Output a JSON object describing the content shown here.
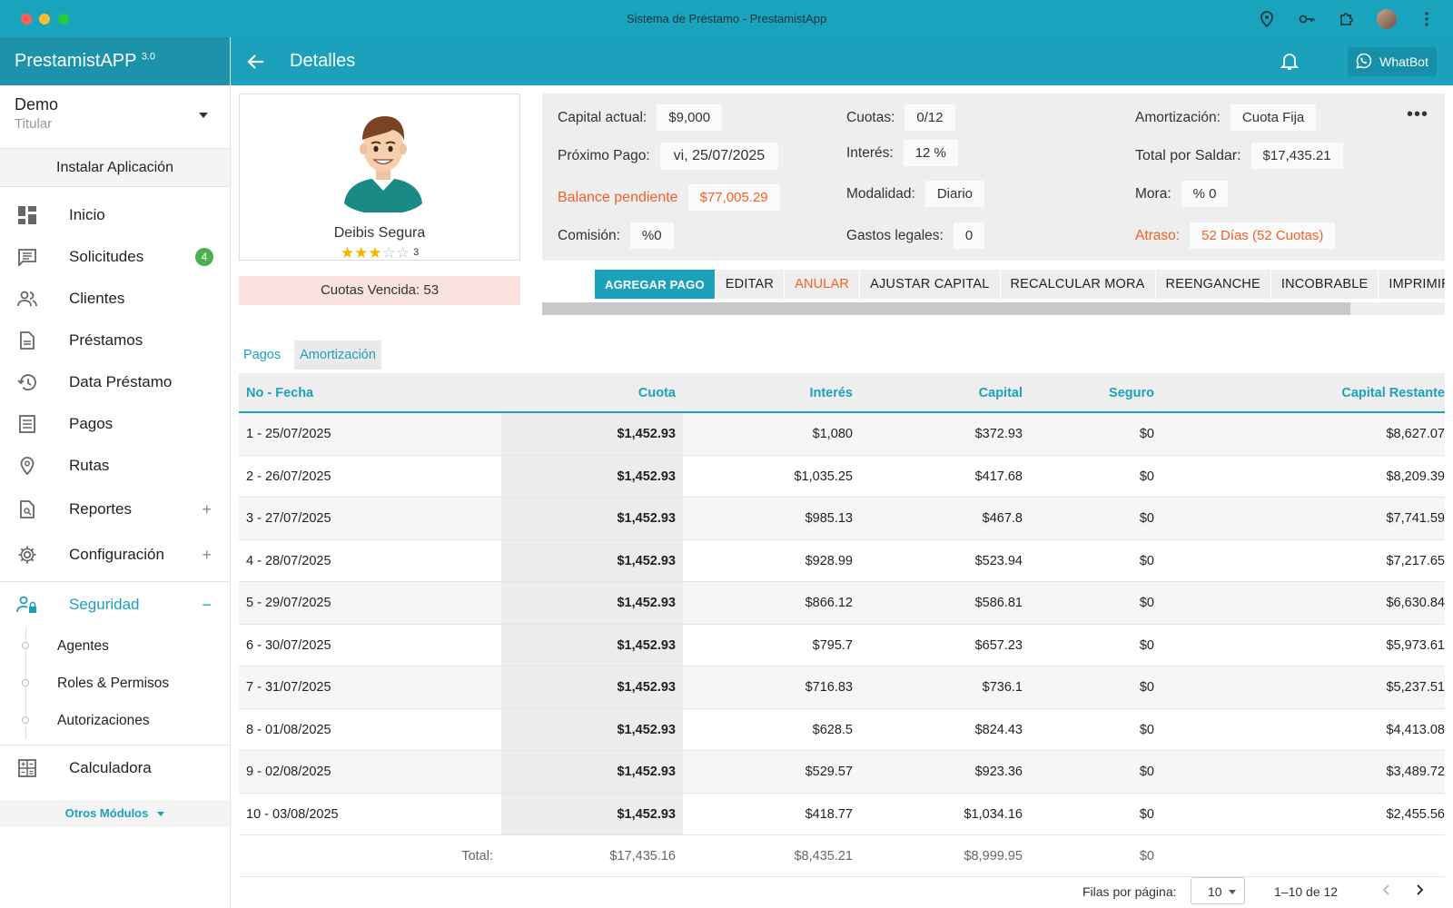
{
  "window": {
    "title": "Sistema de Préstamo - PrestamistApp"
  },
  "brand": {
    "name": "PrestamistAPP",
    "version": "3.0"
  },
  "account": {
    "name": "Demo",
    "role": "Titular"
  },
  "install_label": "Instalar Aplicación",
  "nav": {
    "items": [
      {
        "label": "Inicio",
        "icon": "dashboard-icon"
      },
      {
        "label": "Solicitudes",
        "icon": "chat-icon",
        "badge": "4"
      },
      {
        "label": "Clientes",
        "icon": "people-icon"
      },
      {
        "label": "Préstamos",
        "icon": "document-icon"
      },
      {
        "label": "Data Préstamo",
        "icon": "history-icon"
      },
      {
        "label": "Pagos",
        "icon": "list-icon"
      },
      {
        "label": "Rutas",
        "icon": "location-pin-icon"
      },
      {
        "label": "Reportes",
        "icon": "report-search-icon",
        "expand": "+"
      },
      {
        "label": "Configuración",
        "icon": "gear-icon",
        "expand": "+"
      },
      {
        "label": "Seguridad",
        "icon": "user-lock-icon",
        "expand": "−"
      }
    ],
    "seguridad_sub": [
      "Agentes",
      "Roles & Permisos",
      "Autorizaciones"
    ],
    "calculadora": "Calculadora",
    "otros_modulos": "Otros Módulos"
  },
  "header": {
    "title": "Detalles",
    "whatbot_label": "WhatBot"
  },
  "client": {
    "name": "Deibis Segura",
    "rating_stars": 3,
    "rating_max": 5,
    "rating_count": "3"
  },
  "cuotas_vencida": "Cuotas Vencida: 53",
  "info": {
    "capital_actual": {
      "label": "Capital actual:",
      "value": "$9,000"
    },
    "proximo_pago": {
      "label": "Próximo Pago:",
      "value": "vi, 25/07/2025"
    },
    "balance_pendiente": {
      "label": "Balance pendiente",
      "value": "$77,005.29"
    },
    "comision": {
      "label": "Comisión:",
      "value": "%0"
    },
    "cuotas": {
      "label": "Cuotas:",
      "value": "0/12"
    },
    "interes": {
      "label": "Interés:",
      "value": "12 %"
    },
    "modalidad": {
      "label": "Modalidad:",
      "value": "Diario"
    },
    "gastos_legales": {
      "label": "Gastos legales:",
      "value": "0"
    },
    "amortizacion": {
      "label": "Amortización:",
      "value": "Cuota Fija"
    },
    "total_por_saldar": {
      "label": "Total por Saldar:",
      "value": "$17,435.21"
    },
    "mora": {
      "label": "Mora:",
      "value": "% 0"
    },
    "atraso": {
      "label": "Atraso:",
      "value": "52 Días (52 Cuotas)"
    },
    "more_label": "•••"
  },
  "actions": [
    "AGREGAR PAGO",
    "EDITAR",
    "ANULAR",
    "AJUSTAR CAPITAL",
    "RECALCULAR MORA",
    "REENGANCHE",
    "INCOBRABLE",
    "IMPRIMIR"
  ],
  "tabs": [
    "Pagos",
    "Amortización"
  ],
  "table": {
    "columns": [
      "No - Fecha",
      "Cuota",
      "Interés",
      "Capital",
      "Seguro",
      "Capital Restante"
    ],
    "rows": [
      [
        "1 - 25/07/2025",
        "$1,452.93",
        "$1,080",
        "$372.93",
        "$0",
        "$8,627.07"
      ],
      [
        "2 - 26/07/2025",
        "$1,452.93",
        "$1,035.25",
        "$417.68",
        "$0",
        "$8,209.39"
      ],
      [
        "3 - 27/07/2025",
        "$1,452.93",
        "$985.13",
        "$467.8",
        "$0",
        "$7,741.59"
      ],
      [
        "4 - 28/07/2025",
        "$1,452.93",
        "$928.99",
        "$523.94",
        "$0",
        "$7,217.65"
      ],
      [
        "5 - 29/07/2025",
        "$1,452.93",
        "$866.12",
        "$586.81",
        "$0",
        "$6,630.84"
      ],
      [
        "6 - 30/07/2025",
        "$1,452.93",
        "$795.7",
        "$657.23",
        "$0",
        "$5,973.61"
      ],
      [
        "7 - 31/07/2025",
        "$1,452.93",
        "$716.83",
        "$736.1",
        "$0",
        "$5,237.51"
      ],
      [
        "8 - 01/08/2025",
        "$1,452.93",
        "$628.5",
        "$824.43",
        "$0",
        "$4,413.08"
      ],
      [
        "9 - 02/08/2025",
        "$1,452.93",
        "$529.57",
        "$923.36",
        "$0",
        "$3,489.72"
      ],
      [
        "10 - 03/08/2025",
        "$1,452.93",
        "$418.77",
        "$1,034.16",
        "$0",
        "$2,455.56"
      ]
    ],
    "totals": {
      "label": "Total:",
      "cuota": "$17,435.16",
      "interes": "$8,435.21",
      "capital": "$8,999.95",
      "seguro": "$0"
    }
  },
  "pagination": {
    "rows_label": "Filas por página:",
    "rows_value": "10",
    "range": "1–10 de 12"
  },
  "colors": {
    "primary": "#1ba1bc",
    "header": "#1ba1bc",
    "brand_bar": "#1c93ab",
    "warning": "#f1602a",
    "badge": "#4caf50",
    "star": "#f5b400"
  }
}
